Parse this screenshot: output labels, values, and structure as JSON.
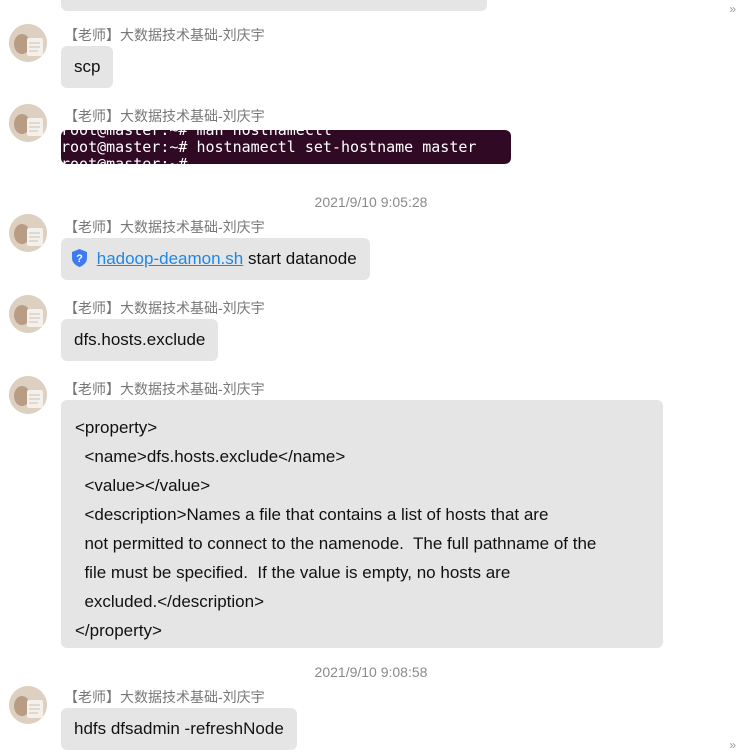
{
  "conversation": {
    "sender": "【老师】大数据技术基础-刘庆宇",
    "messages": [
      {
        "text": "scp"
      },
      {
        "terminal_lines": [
          "root@master:~# man hostnamectl",
          "root@master:~# hostnamectl set-hostname master",
          "root@master:~# "
        ]
      },
      {
        "timestamp": "2021/9/10 9:05:28",
        "link": "hadoop-deamon.sh",
        "rest": " start datanode"
      },
      {
        "text": "dfs.hosts.exclude"
      },
      {
        "code": "<property>\n  <name>dfs.hosts.exclude</name>\n  <value></value>\n  <description>Names a file that contains a list of hosts that are\n  not permitted to connect to the namenode.  The full pathname of the\n  file must be specified.  If the value is empty, no hosts are\n  excluded.</description>\n</property>"
      },
      {
        "timestamp": "2021/9/10 9:08:58",
        "text": "hdfs dfsadmin -refreshNode"
      }
    ]
  },
  "colors": {
    "bubble": "#e5e5e5",
    "terminal_bg": "#300a24",
    "link": "#1e88e5"
  }
}
